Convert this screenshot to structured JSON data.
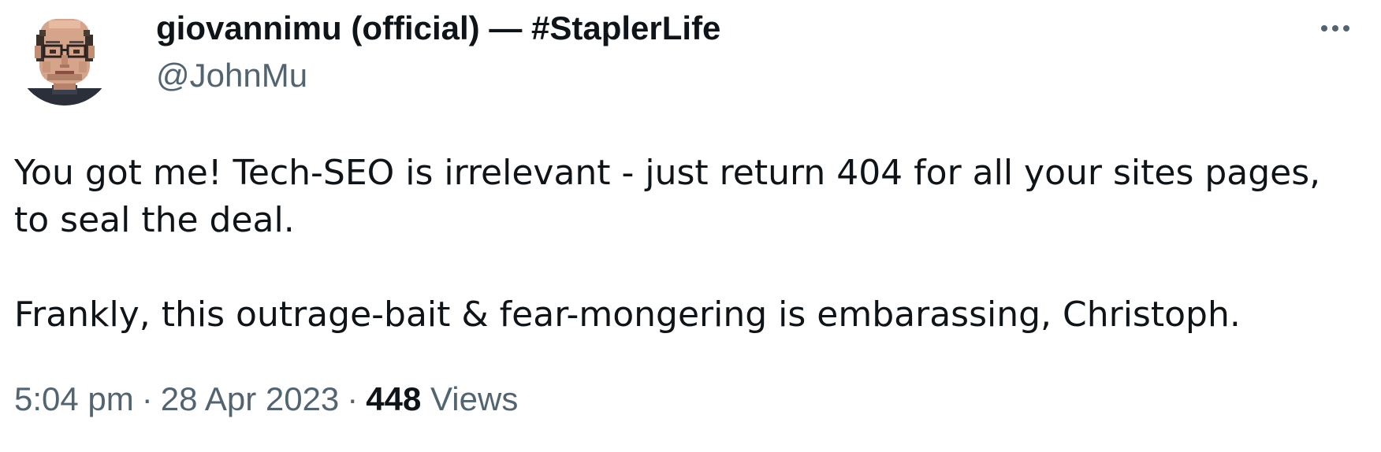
{
  "tweet": {
    "author": {
      "display_name": "giovannimu (official) — #StaplerLife",
      "handle": "@JohnMu",
      "avatar_icon": "pixel-portrait-avatar"
    },
    "more_icon": "more-horizontal-icon",
    "text": {
      "line1": "You got me! Tech-SEO is irrelevant - just return 404 for all your sites pages, to seal the deal.",
      "line2": "Frankly, this outrage-bait & fear-mongering is embarassing, Christoph."
    },
    "meta": {
      "time": "5:04 pm",
      "separator": "·",
      "date": "28 Apr 2023",
      "views_count": "448",
      "views_label": "Views"
    }
  },
  "colors": {
    "primary_text": "#0f1419",
    "secondary_text": "#536471",
    "background": "#ffffff"
  }
}
